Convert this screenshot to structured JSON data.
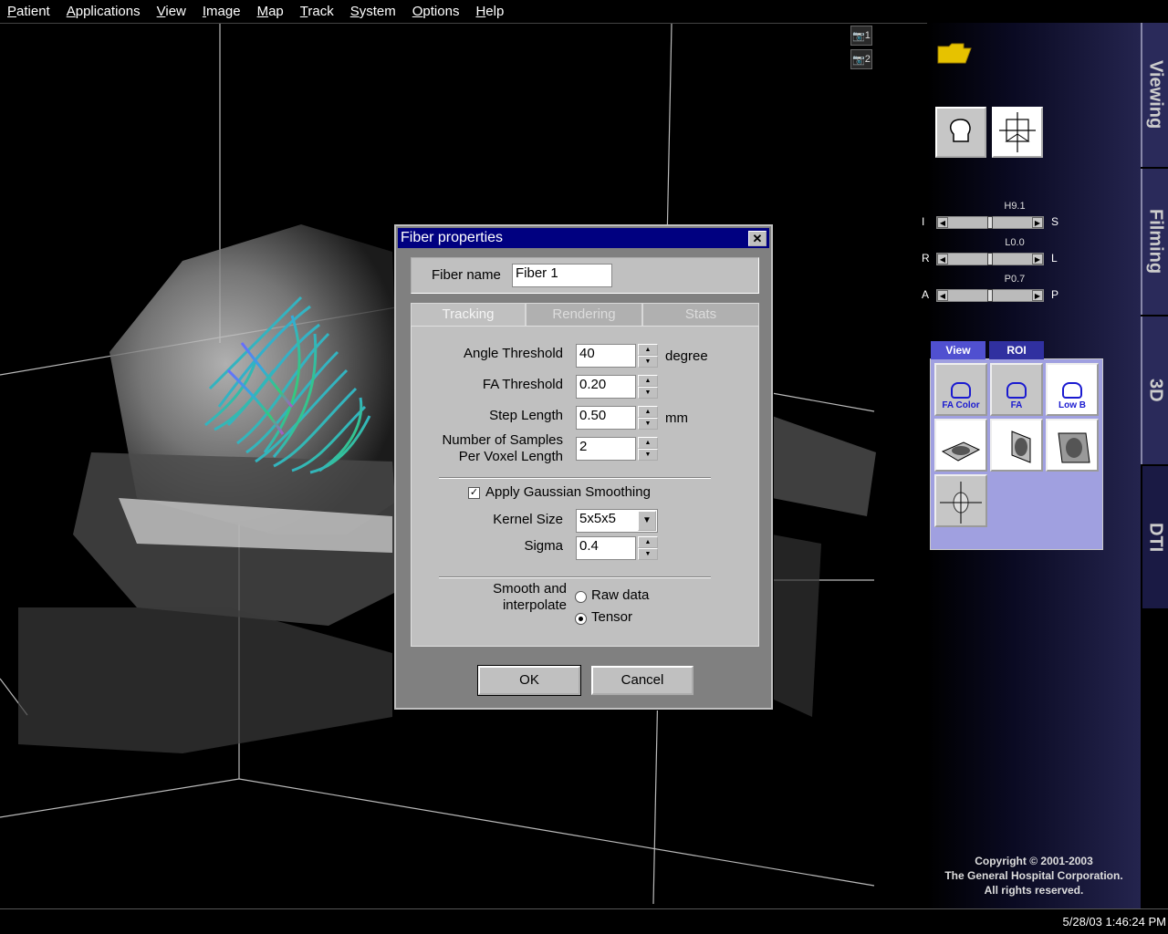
{
  "menubar": {
    "items": [
      "Patient",
      "Applications",
      "View",
      "Image",
      "Map",
      "Track",
      "System",
      "Options",
      "Help"
    ]
  },
  "viewport": {
    "camera_buttons": [
      "1",
      "2"
    ]
  },
  "rightpanel": {
    "sliders": [
      {
        "label": "H9.1",
        "left": "I",
        "right": "S",
        "level": 0.5
      },
      {
        "label": "L0.0",
        "left": "R",
        "right": "L",
        "level": 0.5
      },
      {
        "label": "P0.7",
        "left": "A",
        "right": "P",
        "level": 0.5
      }
    ],
    "dti_tabs": [
      "View",
      "ROI"
    ],
    "dti_buttons": [
      "FA Color",
      "FA",
      "Low B"
    ],
    "copyright": [
      "Copyright © 2001-2003",
      "The General Hospital Corporation.",
      "All rights reserved."
    ]
  },
  "vtabs": [
    "Viewing",
    "Filming",
    "3D",
    "DTI"
  ],
  "status": {
    "datetime": "5/28/03 1:46:24 PM"
  },
  "dialog": {
    "title": "Fiber properties",
    "close": "✕",
    "fiber_name_label": "Fiber name",
    "fiber_name_value": "Fiber 1",
    "tabs": [
      "Tracking",
      "Rendering",
      "Stats"
    ],
    "angle_label": "Angle Threshold",
    "angle_value": "40",
    "angle_unit": "degree",
    "fa_label": "FA Threshold",
    "fa_value": "0.20",
    "step_label": "Step Length",
    "step_value": "0.50",
    "step_unit": "mm",
    "samples_label_1": "Number of Samples",
    "samples_label_2": "Per Voxel Length",
    "samples_value": "2",
    "gaussian_label": "Apply Gaussian Smoothing",
    "gaussian_checked": true,
    "kernel_label": "Kernel Size",
    "kernel_value": "5x5x5",
    "sigma_label": "Sigma",
    "sigma_value": "0.4",
    "smooth_label_1": "Smooth and",
    "smooth_label_2": "interpolate",
    "radio_raw": "Raw data",
    "radio_tensor": "Tensor",
    "ok": "OK",
    "cancel": "Cancel"
  },
  "colors": {
    "dialog_title_bg": "#000080",
    "dti_panel_bg": "#a0a0e0",
    "dti_label": "#1a1ad0"
  }
}
